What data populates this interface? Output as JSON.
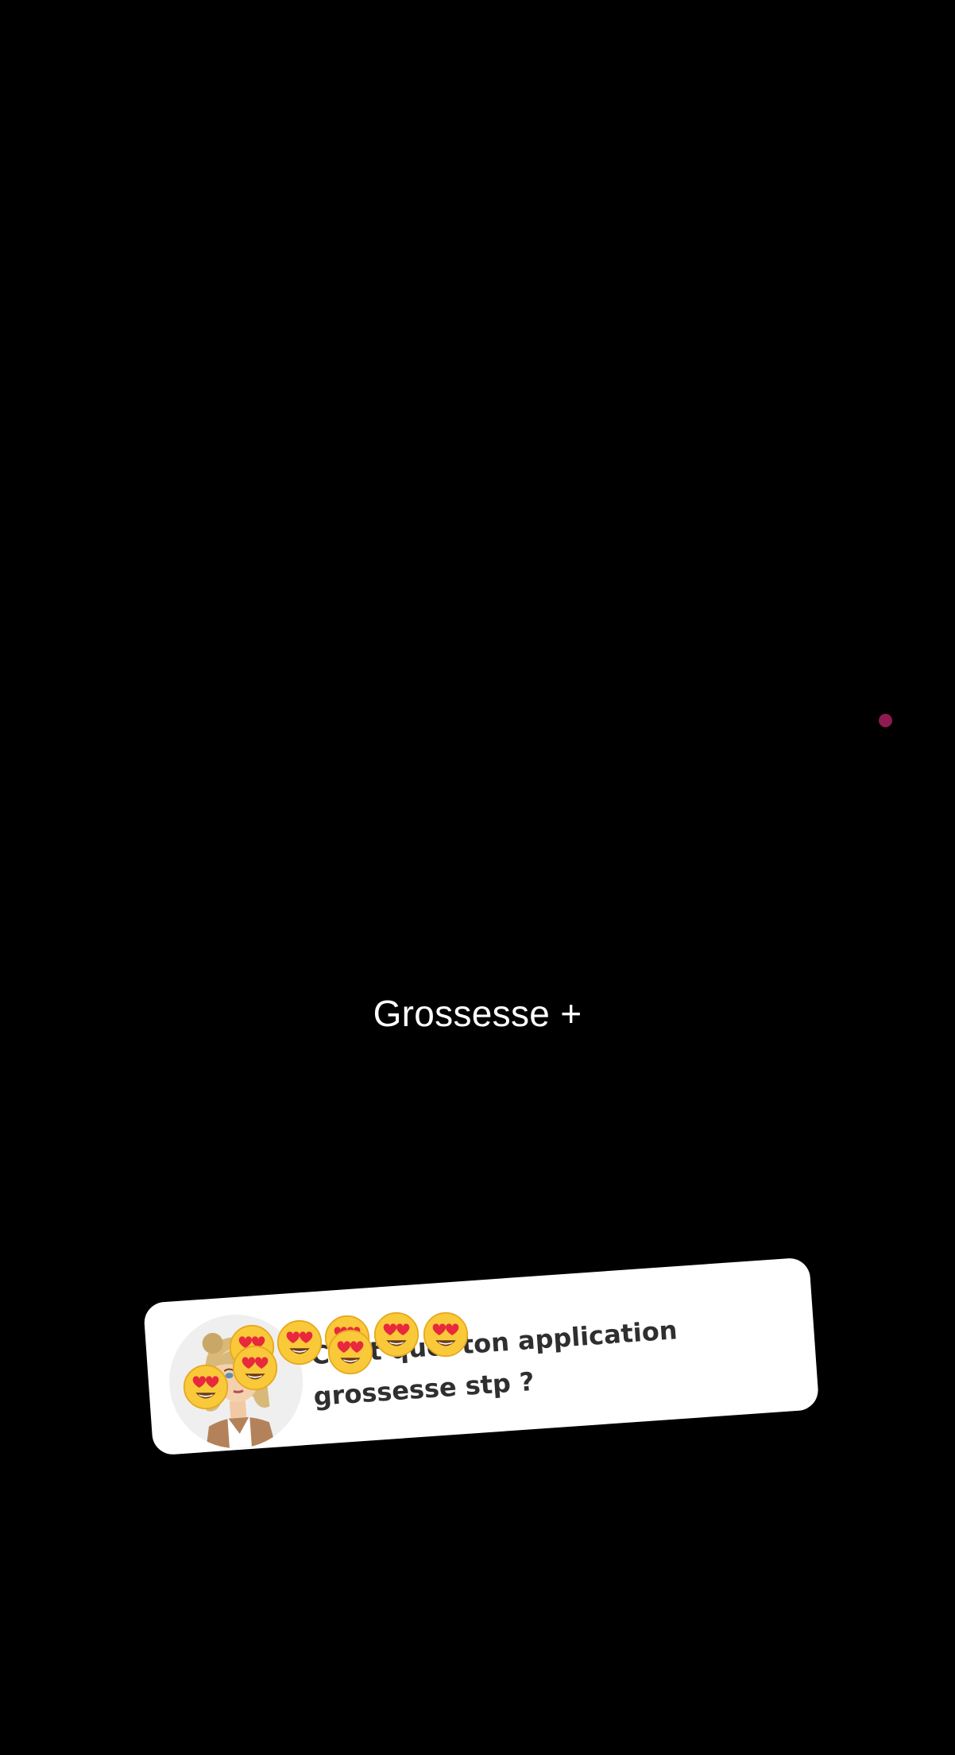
{
  "app": {
    "title": "Grossesse +"
  },
  "sticker": {
    "question": "C'est quoi ton application grossesse stp ?"
  },
  "reactions": {
    "emoji_name": "heart-eyes-emoji",
    "count": 8
  },
  "colors": {
    "background": "#000000",
    "title_text": "#FFFFFF",
    "sticker_bg": "#FFFFFF",
    "question_text": "#2F2F2F",
    "pink_dot": "#8E1B4F",
    "highlight_pink": "#F5A6C6"
  }
}
